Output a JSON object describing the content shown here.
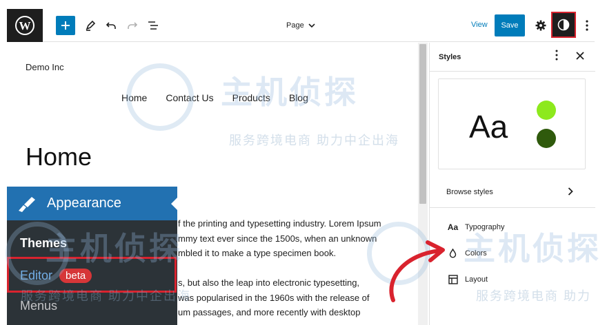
{
  "toolbar": {
    "logo": "wordpress-logo",
    "document_title": "Page",
    "view_label": "View",
    "save_label": "Save"
  },
  "canvas": {
    "site_title": "Demo Inc",
    "nav": [
      "Home",
      "Contact Us",
      "Products",
      "Blog"
    ],
    "page_heading": "Home",
    "body_lines": [
      "f the printing and typesetting industry. Lorem Ipsum",
      "mmy text ever since the 1500s, when an unknown",
      "mbled it to make a type specimen book.",
      "",
      "s, but also the leap into electronic typesetting,",
      "was popularised in the 1960s with the release of",
      "um passages, and more recently with desktop"
    ]
  },
  "admin_menu": {
    "appearance_label": "Appearance",
    "themes_label": "Themes",
    "editor_label": "Editor",
    "beta_label": "beta",
    "menus_label": "Menus",
    "colors": {
      "active_bg": "#2271b1",
      "submenu_bg": "#2c3338",
      "badge": "#d63638",
      "current_link": "#72aee6"
    }
  },
  "sidebar": {
    "title": "Styles",
    "preview_text": "Aa",
    "preview_colors": [
      "#8de91d",
      "#2f5a0c"
    ],
    "browse_styles_label": "Browse styles",
    "nav_items": [
      {
        "label": "Typography",
        "icon": "aa-icon"
      },
      {
        "label": "Colors",
        "icon": "droplet-icon"
      },
      {
        "label": "Layout",
        "icon": "layout-icon"
      }
    ]
  },
  "watermark": {
    "brand_large": "主机侦探",
    "slogan": "服务跨境电商 助力中企出海",
    "slogan_short": "服务跨境电商 助力"
  },
  "accent_colors": {
    "primary": "#007cba",
    "highlight": "#d9232e"
  }
}
